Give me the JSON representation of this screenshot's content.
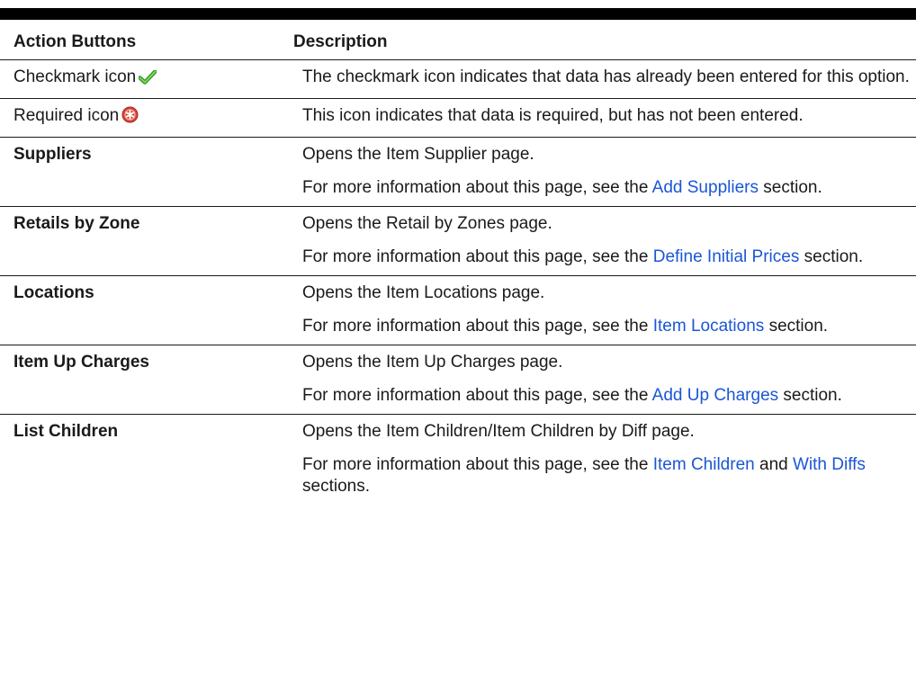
{
  "header": {
    "col_action": "Action Buttons",
    "col_description": "Description"
  },
  "rows": [
    {
      "action": "Checkmark icon",
      "icon": "checkmark-icon",
      "desc": "The checkmark icon indicates that data has already been entered for this option."
    },
    {
      "action": "Required icon",
      "icon": "required-icon",
      "desc": "This icon indicates that data is required, but has not been entered."
    },
    {
      "action": "Suppliers",
      "desc": "Opens the Item Supplier page.",
      "more_prefix": "For more information about this page, see the ",
      "link1": "Add Suppliers",
      "more_suffix": " section."
    },
    {
      "action": "Retails by Zone",
      "desc": "Opens the Retail by Zones page.",
      "more_prefix": "For more information about this page, see the ",
      "link1": "Define Initial Prices",
      "more_suffix": " section."
    },
    {
      "action": "Locations",
      "desc": "Opens the Item Locations page.",
      "more_prefix": "For more information about this page, see the ",
      "link1": "Item Locations",
      "more_suffix": " section."
    },
    {
      "action": "Item Up Charges",
      "desc": "Opens the Item Up Charges page.",
      "more_prefix": "For more information about this page, see the ",
      "link1": "Add Up Charges",
      "more_suffix": " section."
    },
    {
      "action": "List Children",
      "desc": "Opens the Item Children/Item Children by Diff page.",
      "more_prefix": "For more information about this page, see the ",
      "link1": "Item Children",
      "more_mid": " and ",
      "link2": "With Diffs",
      "more_suffix": " sections."
    }
  ],
  "colors": {
    "link": "#1a56d6",
    "check": "#3fae2a",
    "required": "#d9463a",
    "text": "#1a1a1a"
  }
}
